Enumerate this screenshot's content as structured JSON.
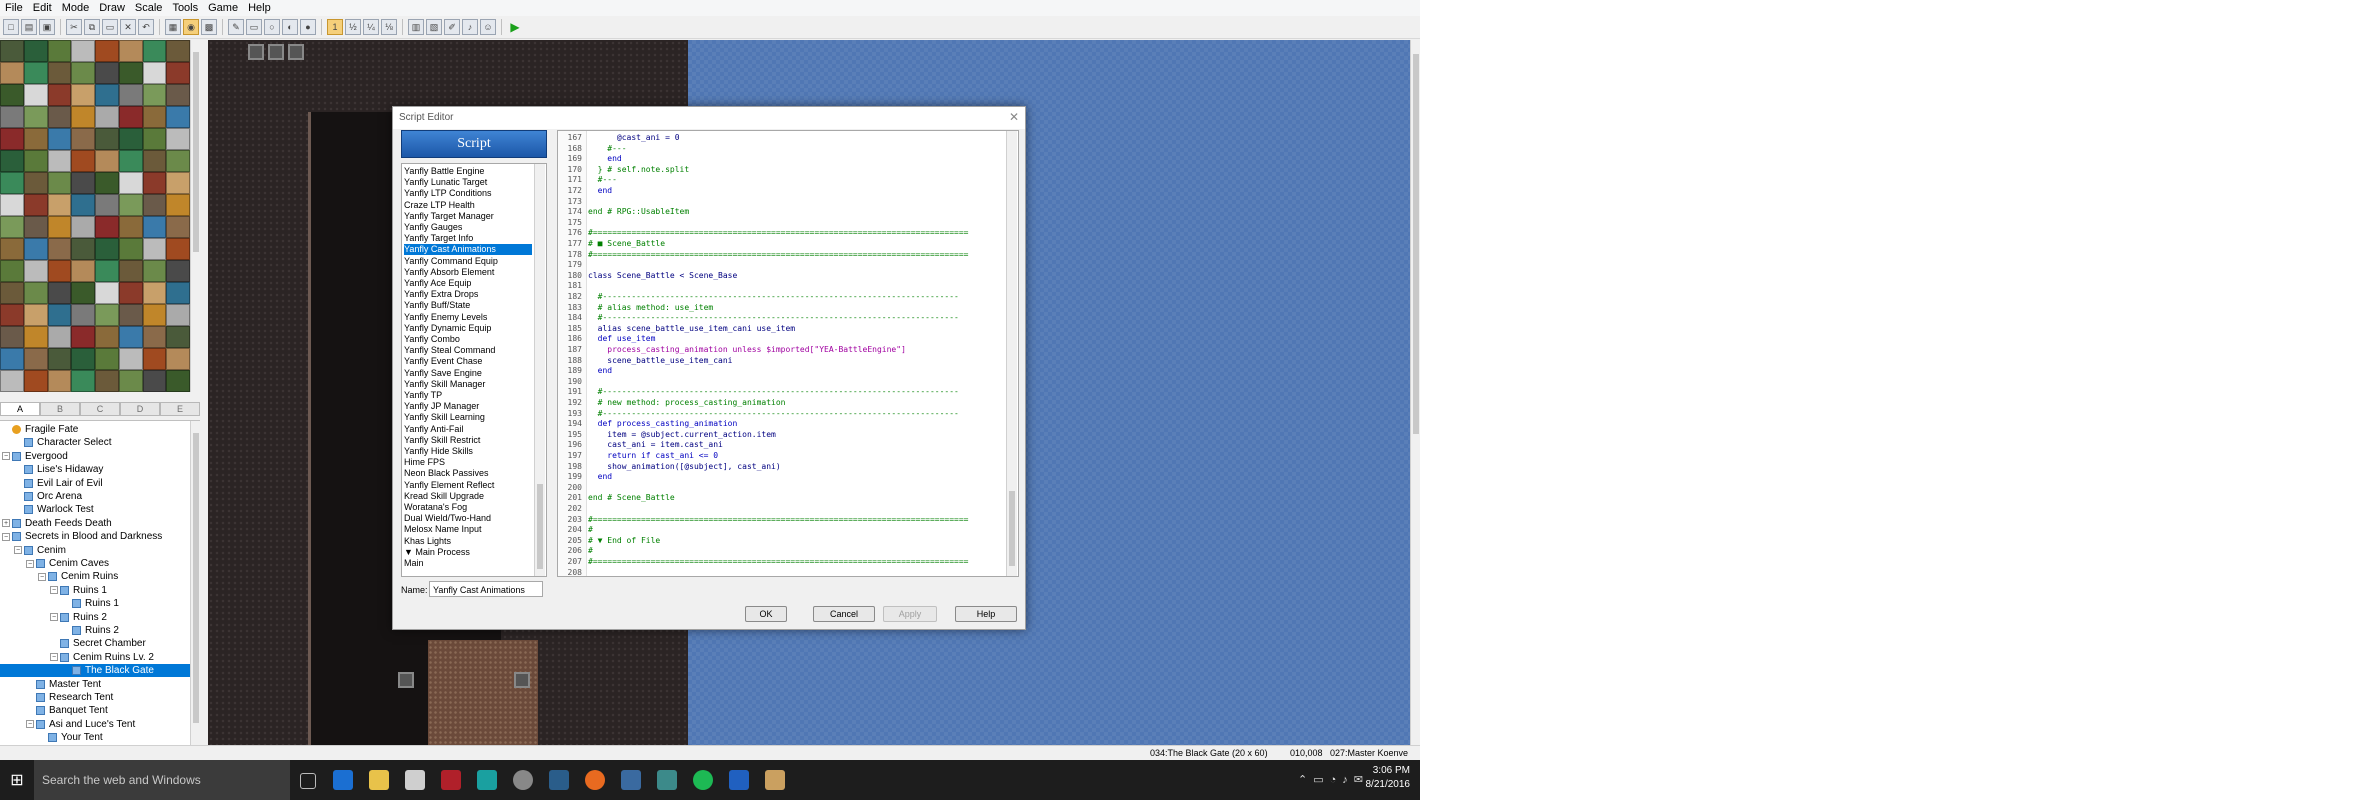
{
  "menubar": [
    "File",
    "Edit",
    "Mode",
    "Draw",
    "Scale",
    "Tools",
    "Game",
    "Help"
  ],
  "tileset_tabs": [
    "A",
    "B",
    "C",
    "D",
    "E"
  ],
  "tileset_colors": [
    "#4a5a3a",
    "#6b5a3a",
    "#2f6f8f",
    "#8a6a3a",
    "#a04a20",
    "#d8d8d8",
    "#c0862a",
    "#2a5f3a",
    "#6b8a4a",
    "#7a7a7a",
    "#3a7aaa",
    "#b48a5a",
    "#8b3a2a",
    "#aaaaaa",
    "#5a7a3a",
    "#4a4a4a",
    "#7a9a5a",
    "#8a6a4a",
    "#3a8a5a",
    "#c8a06a",
    "#8a2a2a",
    "#bbbbbb",
    "#3a5a2a",
    "#6a5a4a"
  ],
  "map_tree": [
    {
      "label": "Fragile Fate",
      "level": 0,
      "exp": "",
      "icon": "root"
    },
    {
      "label": "Character Select",
      "level": 1,
      "exp": "",
      "icon": "map"
    },
    {
      "label": "Evergood",
      "level": 0,
      "exp": "−",
      "icon": "map"
    },
    {
      "label": "Lise's Hidaway",
      "level": 1,
      "exp": "",
      "icon": "map"
    },
    {
      "label": "Evil Lair of Evil",
      "level": 1,
      "exp": "",
      "icon": "map"
    },
    {
      "label": "Orc Arena",
      "level": 1,
      "exp": "",
      "icon": "map"
    },
    {
      "label": "Warlock Test",
      "level": 1,
      "exp": "",
      "icon": "map"
    },
    {
      "label": "Death Feeds Death",
      "level": 0,
      "exp": "+",
      "icon": "map"
    },
    {
      "label": "Secrets in Blood and Darkness",
      "level": 0,
      "exp": "−",
      "icon": "map"
    },
    {
      "label": "Cenim",
      "level": 1,
      "exp": "−",
      "icon": "map"
    },
    {
      "label": "Cenim Caves",
      "level": 2,
      "exp": "−",
      "icon": "map"
    },
    {
      "label": "Cenim Ruins",
      "level": 3,
      "exp": "−",
      "icon": "map"
    },
    {
      "label": "Ruins 1",
      "level": 4,
      "exp": "−",
      "icon": "map"
    },
    {
      "label": "Ruins 1",
      "level": 5,
      "exp": "",
      "icon": "map"
    },
    {
      "label": "Ruins 2",
      "level": 4,
      "exp": "−",
      "icon": "map"
    },
    {
      "label": "Ruins 2",
      "level": 5,
      "exp": "",
      "icon": "map"
    },
    {
      "label": "Secret Chamber",
      "level": 4,
      "exp": "",
      "icon": "map"
    },
    {
      "label": "Cenim Ruins Lv. 2",
      "level": 4,
      "exp": "−",
      "icon": "map"
    },
    {
      "label": "The Black Gate",
      "level": 5,
      "exp": "",
      "icon": "map",
      "selected": true
    },
    {
      "label": "Master Tent",
      "level": 2,
      "exp": "",
      "icon": "map"
    },
    {
      "label": "Research Tent",
      "level": 2,
      "exp": "",
      "icon": "map"
    },
    {
      "label": "Banquet Tent",
      "level": 2,
      "exp": "",
      "icon": "map"
    },
    {
      "label": "Asi and Luce's Tent",
      "level": 2,
      "exp": "−",
      "icon": "map"
    },
    {
      "label": "Your Tent",
      "level": 3,
      "exp": "",
      "icon": "map"
    }
  ],
  "dialog": {
    "title": "Script Editor",
    "banner": "Script",
    "name_label": "Name:",
    "name_value": "Yanfly Cast Animations",
    "buttons": {
      "ok": "OK",
      "cancel": "Cancel",
      "apply": "Apply",
      "help": "Help"
    }
  },
  "scripts": [
    "Yanfly Battle Engine",
    "Yanfly Lunatic Target",
    "Yanfly LTP Conditions",
    "Craze LTP Health",
    "Yanfly Target Manager",
    "Yanfly Gauges",
    "Yanfly Target Info",
    "Yanfly Cast Animations",
    "Yanfly Command Equip",
    "Yanfly Absorb Element",
    "Yanfly Ace Equip",
    "Yanfly Extra Drops",
    "Yanfly Buff/State",
    "Yanfly Enemy Levels",
    "Yanfly Dynamic Equip",
    "Yanfly Combo",
    "Yanfly Steal Command",
    "Yanfly Event Chase",
    "Yanfly Save Engine",
    "Yanfly Skill Manager",
    "Yanfly TP",
    "Yanfly JP Manager",
    "Yanfly Skill Learning",
    "Yanfly Anti-Fail",
    "Yanfly Skill Restrict",
    "Yanfly Hide Skills",
    "Hime FPS",
    "Neon Black Passives",
    "Yanfly Element Reflect",
    "Kread Skill Upgrade",
    "Woratana's Fog",
    "Dual Wield/Two-Hand",
    "Melosx Name Input",
    "Khas Lights",
    "▼ Main Process",
    "Main"
  ],
  "selected_script_index": 7,
  "code_lines": [
    {
      "n": "167",
      "t": "      @cast_ani = 0",
      "c": "norm"
    },
    {
      "n": "168",
      "t": "    #---",
      "c": "comment"
    },
    {
      "n": "169",
      "t": "    end",
      "c": "kw"
    },
    {
      "n": "170",
      "t": "  } # self.note.split",
      "c": "comment"
    },
    {
      "n": "171",
      "t": "  #---",
      "c": "comment"
    },
    {
      "n": "172",
      "t": "  end",
      "c": "kw"
    },
    {
      "n": "173",
      "t": "",
      "c": "norm"
    },
    {
      "n": "174",
      "t": "end # RPG::UsableItem",
      "c": "comment"
    },
    {
      "n": "175",
      "t": "",
      "c": "norm"
    },
    {
      "n": "176",
      "t": "#==============================================================================",
      "c": "comment"
    },
    {
      "n": "177",
      "t": "# ■ Scene_Battle",
      "c": "comment"
    },
    {
      "n": "178",
      "t": "#==============================================================================",
      "c": "comment"
    },
    {
      "n": "179",
      "t": "",
      "c": "norm"
    },
    {
      "n": "180",
      "t": "class Scene_Battle < Scene_Base",
      "c": "norm"
    },
    {
      "n": "181",
      "t": "",
      "c": "norm"
    },
    {
      "n": "182",
      "t": "  #--------------------------------------------------------------------------",
      "c": "comment"
    },
    {
      "n": "183",
      "t": "  # alias method: use_item",
      "c": "comment"
    },
    {
      "n": "184",
      "t": "  #--------------------------------------------------------------------------",
      "c": "comment"
    },
    {
      "n": "185",
      "t": "  alias scene_battle_use_item_cani use_item",
      "c": "norm"
    },
    {
      "n": "186",
      "t": "  def use_item",
      "c": "kw"
    },
    {
      "n": "187",
      "t": "    process_casting_animation unless $imported[\"YEA-BattleEngine\"]",
      "c": "str"
    },
    {
      "n": "188",
      "t": "    scene_battle_use_item_cani",
      "c": "norm"
    },
    {
      "n": "189",
      "t": "  end",
      "c": "kw"
    },
    {
      "n": "190",
      "t": "",
      "c": "norm"
    },
    {
      "n": "191",
      "t": "  #--------------------------------------------------------------------------",
      "c": "comment"
    },
    {
      "n": "192",
      "t": "  # new method: process_casting_animation",
      "c": "comment"
    },
    {
      "n": "193",
      "t": "  #--------------------------------------------------------------------------",
      "c": "comment"
    },
    {
      "n": "194",
      "t": "  def process_casting_animation",
      "c": "kw"
    },
    {
      "n": "195",
      "t": "    item = @subject.current_action.item",
      "c": "norm"
    },
    {
      "n": "196",
      "t": "    cast_ani = item.cast_ani",
      "c": "norm"
    },
    {
      "n": "197",
      "t": "    return if cast_ani <= 0",
      "c": "kw"
    },
    {
      "n": "198",
      "t": "    show_animation([@subject], cast_ani)",
      "c": "norm"
    },
    {
      "n": "199",
      "t": "  end",
      "c": "kw"
    },
    {
      "n": "200",
      "t": "",
      "c": "norm"
    },
    {
      "n": "201",
      "t": "end # Scene_Battle",
      "c": "comment"
    },
    {
      "n": "202",
      "t": "",
      "c": "norm"
    },
    {
      "n": "203",
      "t": "#==============================================================================",
      "c": "comment"
    },
    {
      "n": "204",
      "t": "#",
      "c": "comment"
    },
    {
      "n": "205",
      "t": "# ▼ End of File",
      "c": "comment"
    },
    {
      "n": "206",
      "t": "#",
      "c": "comment"
    },
    {
      "n": "207",
      "t": "#==============================================================================",
      "c": "comment"
    },
    {
      "n": "208",
      "t": "",
      "c": "norm"
    }
  ],
  "status": {
    "map": "034:The Black Gate (20 x 60)",
    "coords": "010,008",
    "event": "027:Master Koenve"
  },
  "taskbar": {
    "search_placeholder": "Search the web and Windows",
    "time": "3:06 PM",
    "date": "8/21/2016"
  }
}
